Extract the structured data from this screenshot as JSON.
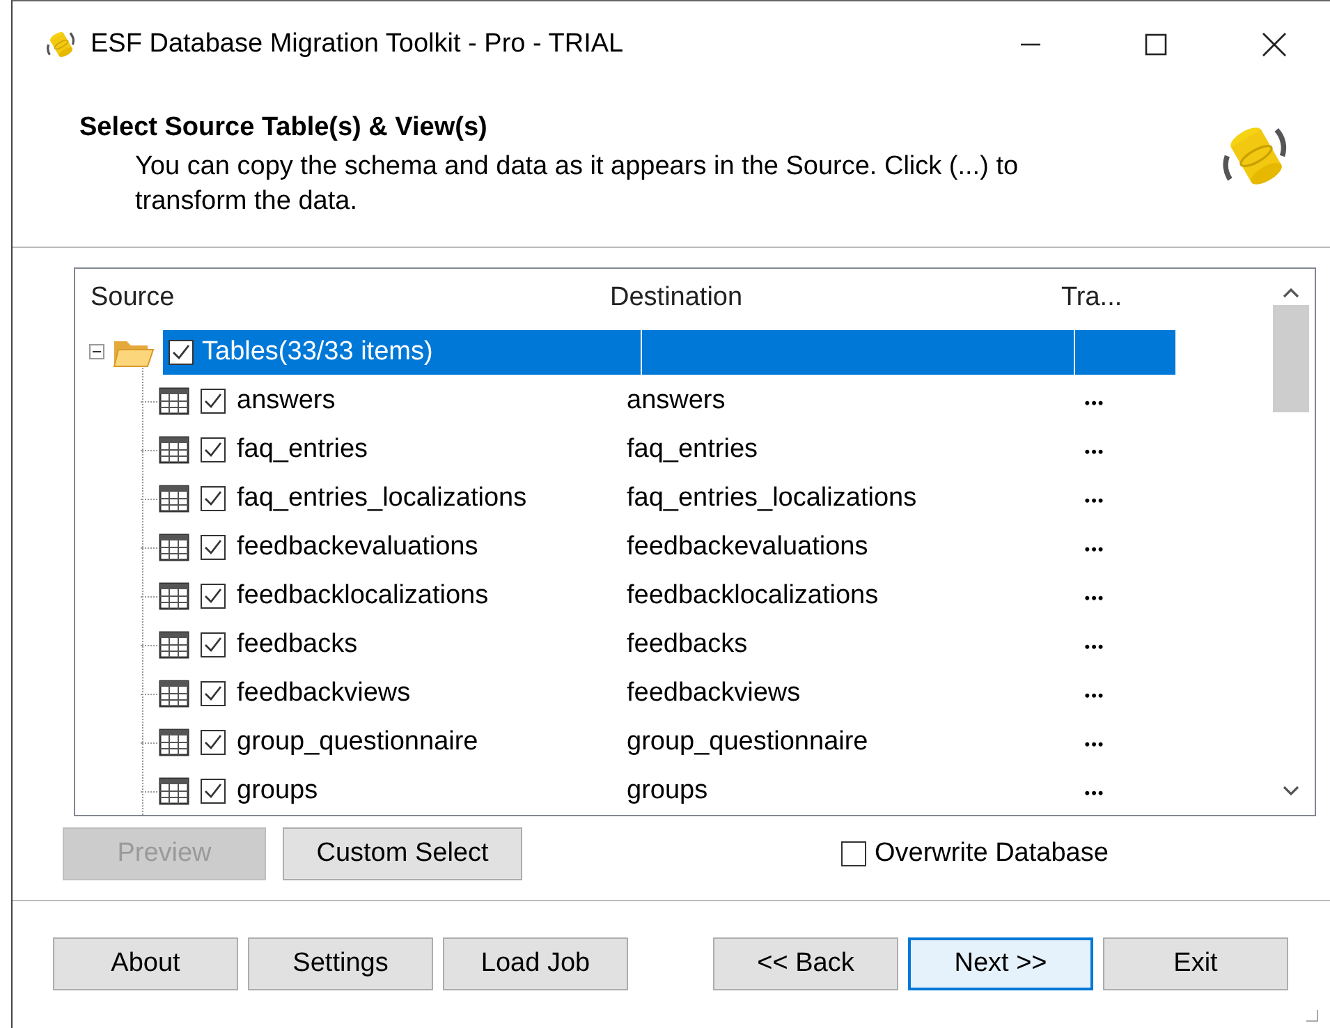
{
  "window": {
    "title": "ESF Database Migration Toolkit - Pro - TRIAL"
  },
  "header": {
    "title": "Select Source Table(s) & View(s)",
    "description": "You can copy the schema and data as it appears in the Source. Click (...) to transform the data."
  },
  "table": {
    "columns": [
      "Source",
      "Destination",
      "Tra..."
    ],
    "root": {
      "label": "Tables(33/33 items)",
      "checked": true,
      "expanded": true,
      "selected": true,
      "children": [
        {
          "source": "answers",
          "destination": "answers",
          "transform": "•••",
          "checked": true
        },
        {
          "source": "faq_entries",
          "destination": "faq_entries",
          "transform": "•••",
          "checked": true
        },
        {
          "source": "faq_entries_localizations",
          "destination": "faq_entries_localizations",
          "transform": "•••",
          "checked": true
        },
        {
          "source": "feedbackevaluations",
          "destination": "feedbackevaluations",
          "transform": "•••",
          "checked": true
        },
        {
          "source": "feedbacklocalizations",
          "destination": "feedbacklocalizations",
          "transform": "•••",
          "checked": true
        },
        {
          "source": "feedbacks",
          "destination": "feedbacks",
          "transform": "•••",
          "checked": true
        },
        {
          "source": "feedbackviews",
          "destination": "feedbackviews",
          "transform": "•••",
          "checked": true
        },
        {
          "source": "group_questionnaire",
          "destination": "group_questionnaire",
          "transform": "•••",
          "checked": true
        },
        {
          "source": "groups",
          "destination": "groups",
          "transform": "•••",
          "checked": true
        }
      ]
    }
  },
  "actions": [
    {
      "label": "Preview",
      "disabled": true
    },
    {
      "label": "Custom Select",
      "disabled": false
    }
  ],
  "overwrite": {
    "label": "Overwrite Database",
    "checked": false
  },
  "footer_left": [
    {
      "label": "About",
      "default": false
    },
    {
      "label": "Settings",
      "default": false
    },
    {
      "label": "Load Job",
      "default": false
    }
  ],
  "footer_right": [
    {
      "label": "<< Back",
      "default": false
    },
    {
      "label": "Next >>",
      "default": true
    },
    {
      "label": "Exit",
      "default": false
    }
  ]
}
